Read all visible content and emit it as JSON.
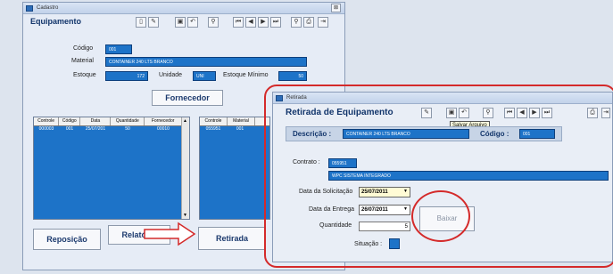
{
  "main": {
    "window_title": "Cadastro",
    "heading": "Equipamento",
    "codigo_label": "Código",
    "codigo_value": "001",
    "material_label": "Material",
    "material_value": "CONTAINER 240 LTS BRANCO",
    "estoque_label": "Estoque",
    "estoque_value": "172",
    "unidade_label": "Unidade",
    "unidade_value": "UNI",
    "estoque_min_label": "Estoque Mínimo",
    "estoque_min_value": "50",
    "fornecedor_button": "Fornecedor",
    "grid_left": {
      "columns": [
        "Controle",
        "Código",
        "Data",
        "Quantidade",
        "Fornecedor"
      ],
      "rows": [
        [
          "000003",
          "001",
          "25/07/201",
          "50",
          "00010"
        ]
      ]
    },
    "grid_right": {
      "columns": [
        "Controle",
        "Material"
      ],
      "rows": [
        [
          "055951",
          "001"
        ]
      ]
    },
    "reposicao_button": "Reposição",
    "relatorio_button": "Relatório",
    "retirada_button": "Retirada"
  },
  "retirada": {
    "window_title": "Retirada",
    "heading": "Retirada de Equipamento",
    "tooltip": "Salvar Arquivo",
    "descricao_label": "Descrição :",
    "descricao_value": "CONTAINER 240 LTS BRANCO",
    "codigo_label": "Código :",
    "codigo_value": "001",
    "contrato_label": "Contrato :",
    "contrato_value": "055951",
    "contrato_name": "WPC SISTEMA INTEGRADO",
    "data_solicitacao_label": "Data da Solicitação",
    "data_solicitacao_value": "25/07/2011",
    "data_entrega_label": "Data da Entrega",
    "data_entrega_value": "26/07/2011",
    "quantidade_label": "Quantidade",
    "quantidade_value": "5",
    "situacao_label": "Situação :",
    "baixar_button": "Baixar"
  },
  "icons": {
    "window": "window-icon",
    "new": "new-record-icon",
    "edit": "edit-icon",
    "save": "save-icon",
    "undo": "undo-icon",
    "search": "search-icon",
    "first": "first-record-icon",
    "prev": "previous-record-icon",
    "next": "next-record-icon",
    "last": "last-record-icon",
    "print": "print-icon",
    "exit": "exit-icon"
  },
  "colors": {
    "field_blue": "#1d73c8",
    "highlight_red": "#d42a2a",
    "date_field": "#fffbd5",
    "heading": "#12356b"
  }
}
